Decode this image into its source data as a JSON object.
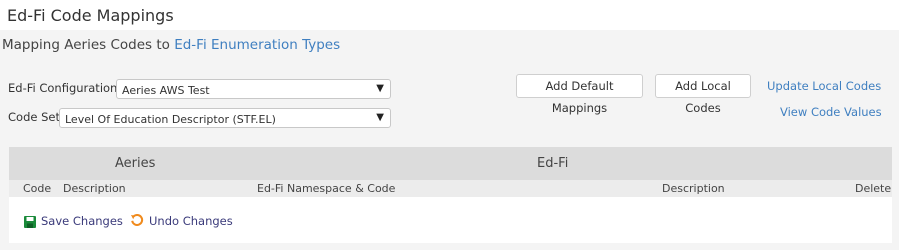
{
  "page_title": "Ed-Fi Code Mappings",
  "subtitle": {
    "prefix": "Mapping Aeries Codes to ",
    "link": "Ed-Fi Enumeration Types"
  },
  "form": {
    "configuration_label": "Ed-Fi Configuration:",
    "configuration_value": "Aeries AWS Test",
    "codeset_label": "Code Set:",
    "codeset_value": "Level Of Education Descriptor (STF.EL)"
  },
  "buttons": {
    "add_default": "Add Default Mappings",
    "add_local": "Add Local Codes"
  },
  "links": {
    "update_local": "Update Local Codes",
    "view_values": "View Code Values"
  },
  "grid": {
    "group_aeries": "Aeries",
    "group_edfi": "Ed-Fi",
    "columns": {
      "code": "Code",
      "description": "Description",
      "namespace": "Ed-Fi Namespace & Code",
      "edfi_description": "Description",
      "delete": "Delete"
    }
  },
  "actions": {
    "save": "Save Changes",
    "undo": "Undo Changes"
  },
  "colors": {
    "link": "#3f7fc0",
    "save_icon": "#1a8a3a",
    "undo_icon": "#f08a1c"
  }
}
